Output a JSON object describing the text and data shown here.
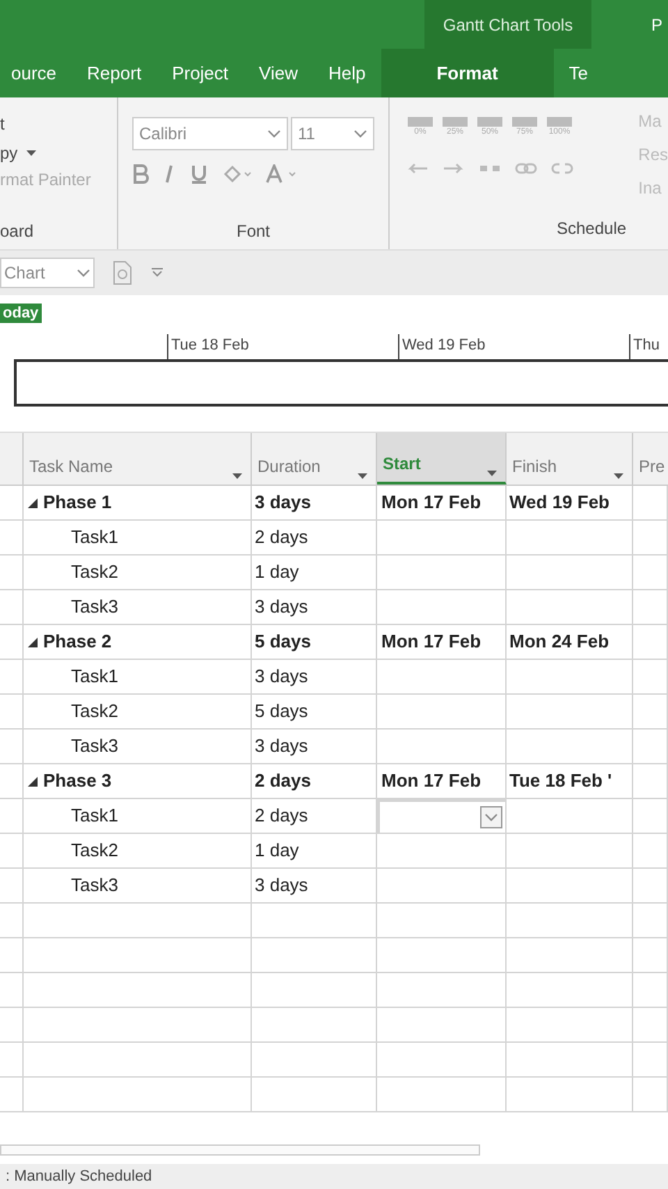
{
  "contextual_tab_group": {
    "title": "Gantt Chart Tools",
    "next_title": "P"
  },
  "ribbon_tabs": [
    {
      "label": "ource",
      "selected": false
    },
    {
      "label": "Report",
      "selected": false
    },
    {
      "label": "Project",
      "selected": false
    },
    {
      "label": "View",
      "selected": false
    },
    {
      "label": "Help",
      "selected": false
    },
    {
      "label": "Format",
      "selected": true
    },
    {
      "label": "Te",
      "selected": false
    }
  ],
  "clipboard_group": {
    "items": [
      "t",
      "py",
      "rmat Painter"
    ],
    "label": "oard"
  },
  "font_group": {
    "font": "Calibri",
    "size": "11",
    "label": "Font"
  },
  "schedule_group": {
    "percent_buttons": [
      "0%",
      "25%",
      "50%",
      "75%",
      "100%"
    ],
    "label": "Schedule",
    "side_items": [
      "Ma",
      "Res",
      "Ina"
    ]
  },
  "view_bar": {
    "view": "Chart"
  },
  "timeline": {
    "today": "oday",
    "dates": [
      "Tue 18 Feb",
      "Wed 19 Feb",
      "Thu"
    ]
  },
  "table": {
    "columns": [
      {
        "label": "Task Name",
        "selected": false
      },
      {
        "label": "Duration",
        "selected": false
      },
      {
        "label": "Start",
        "selected": true
      },
      {
        "label": "Finish",
        "selected": false
      },
      {
        "label": "Pre",
        "selected": false
      }
    ],
    "rows": [
      {
        "name": "Phase 1",
        "duration": "3 days",
        "start": "Mon 17 Feb",
        "finish": "Wed 19 Feb",
        "expanded": true,
        "children": [
          {
            "name": "Task1",
            "duration": "2 days",
            "editing": false
          },
          {
            "name": "Task2",
            "duration": "1 day",
            "editing": false
          },
          {
            "name": "Task3",
            "duration": "3 days",
            "editing": false
          }
        ]
      },
      {
        "name": "Phase 2",
        "duration": "5 days",
        "start": "Mon 17 Feb",
        "finish": "Mon 24 Feb",
        "expanded": true,
        "children": [
          {
            "name": "Task1",
            "duration": "3 days",
            "editing": false
          },
          {
            "name": "Task2",
            "duration": "5 days",
            "editing": false
          },
          {
            "name": "Task3",
            "duration": "3 days",
            "editing": false
          }
        ]
      },
      {
        "name": "Phase 3",
        "duration": "2 days",
        "start": "Mon 17 Feb",
        "finish": "Tue 18 Feb '",
        "expanded": true,
        "children": [
          {
            "name": "Task1",
            "duration": "2 days",
            "editing": true
          },
          {
            "name": "Task2",
            "duration": "1 day",
            "editing": false
          },
          {
            "name": "Task3",
            "duration": "3 days",
            "editing": false
          }
        ]
      }
    ]
  },
  "status_bar": {
    "text": ": Manually Scheduled"
  }
}
